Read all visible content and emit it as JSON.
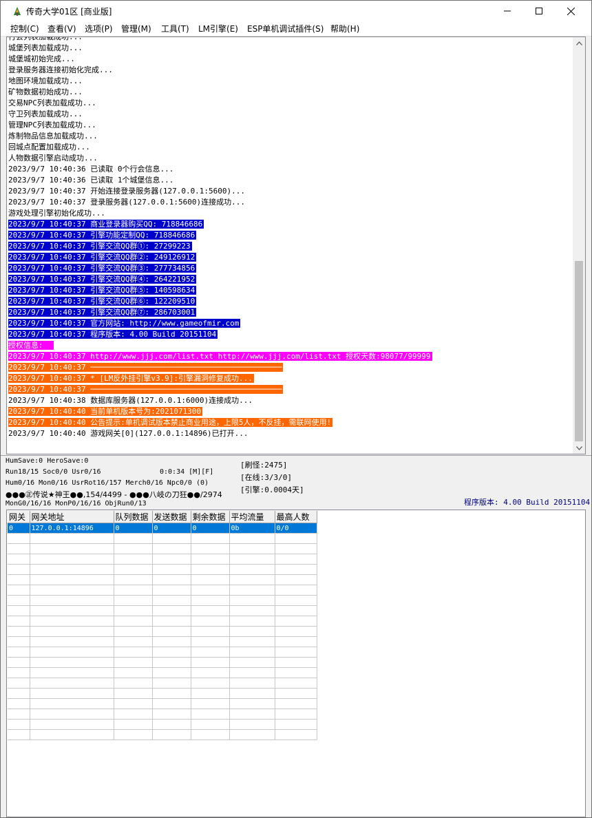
{
  "window": {
    "title": "传奇大学01区 [商业版]"
  },
  "menu": [
    {
      "label": "控制(C)"
    },
    {
      "label": "查看(V)"
    },
    {
      "label": "选项(P)"
    },
    {
      "label": "管理(M)"
    },
    {
      "label": "工具(T)"
    },
    {
      "label": "LM引擎(E)"
    },
    {
      "label": "ESP单机调试插件(S)"
    },
    {
      "label": "帮助(H)"
    }
  ],
  "log": [
    {
      "text": "行会列表加载成功...",
      "style": "plain"
    },
    {
      "text": "城堡列表加载成功...",
      "style": "plain"
    },
    {
      "text": "城堡城初始完成...",
      "style": "plain"
    },
    {
      "text": "登录服务器连接初始化完成...",
      "style": "plain"
    },
    {
      "text": "地图环境加载成功...",
      "style": "plain"
    },
    {
      "text": "矿物数据初始成功...",
      "style": "plain"
    },
    {
      "text": "交易NPC列表加载成功...",
      "style": "plain"
    },
    {
      "text": "守卫列表加载成功...",
      "style": "plain"
    },
    {
      "text": "管理NPC列表加载成功...",
      "style": "plain"
    },
    {
      "text": "炼制物品信息加载成功...",
      "style": "plain"
    },
    {
      "text": "回城点配置加载成功...",
      "style": "plain"
    },
    {
      "text": "人物数据引擎启动成功...",
      "style": "plain"
    },
    {
      "text": "2023/9/7 10:40:36 已读取 0个行会信息...",
      "style": "plain"
    },
    {
      "text": "2023/9/7 10:40:36 已读取 1个城堡信息...",
      "style": "plain"
    },
    {
      "text": "2023/9/7 10:40:37 开始连接登录服务器(127.0.0.1:5600)...",
      "style": "plain"
    },
    {
      "text": "2023/9/7 10:40:37 登录服务器(127.0.0.1:5600)连接成功...",
      "style": "plain"
    },
    {
      "text": "游戏处理引擎初始化成功...",
      "style": "plain"
    },
    {
      "text": "2023/9/7 10:40:37 商业登录器购买QQ: 718846686",
      "style": "blue"
    },
    {
      "text": "2023/9/7 10:40:37 引擎功能定制QQ: 718846686",
      "style": "blue"
    },
    {
      "text": "2023/9/7 10:40:37 引擎交流QQ群①: 27299223",
      "style": "blue"
    },
    {
      "text": "2023/9/7 10:40:37 引擎交流QQ群②: 249126912",
      "style": "blue"
    },
    {
      "text": "2023/9/7 10:40:37 引擎交流QQ群③: 277734856",
      "style": "blue"
    },
    {
      "text": "2023/9/7 10:40:37 引擎交流QQ群④: 264221952",
      "style": "blue"
    },
    {
      "text": "2023/9/7 10:40:37 引擎交流QQ群⑤: 140598634",
      "style": "blue"
    },
    {
      "text": "2023/9/7 10:40:37 引擎交流QQ群⑥: 122209510",
      "style": "blue"
    },
    {
      "text": "2023/9/7 10:40:37 引擎交流QQ群⑦: 286703001",
      "style": "blue"
    },
    {
      "text": "2023/9/7 10:40:37 官方网站: http://www.gameofmir.com",
      "style": "blue"
    },
    {
      "text": "2023/9/7 10:40:37 程序版本: 4.00 Build 20151104",
      "style": "blue"
    },
    {
      "text": "授权信息:  ",
      "style": "magenta"
    },
    {
      "text": "2023/9/7 10:40:37 http://www.jjj.com/list.txt http://www.jjj.com/list.txt 授权天数:98077/99999",
      "style": "magenta"
    },
    {
      "text": "2023/9/7 10:40:37 ──────────────────────────────────────────",
      "style": "orange"
    },
    {
      "text": "2023/9/7 10:40:37 * [LM反外挂引擎v3.9]:引擎漏洞修复成功...",
      "style": "orange"
    },
    {
      "text": "2023/9/7 10:40:37 ──────────────────────────────────────────",
      "style": "orange"
    },
    {
      "text": "2023/9/7 10:40:38 数据库服务器(127.0.0.1:6000)连接成功...",
      "style": "plain"
    },
    {
      "text": "2023/9/7 10:40:40 当前单机版本号为:2021071300",
      "style": "orange"
    },
    {
      "text": "2023/9/7 10:40:40 公告提示:单机调试版本禁止商业用途，上限5人，不反挂，需联网使用!",
      "style": "orange"
    },
    {
      "text": "2023/9/7 10:40:40 游戏网关[0](127.0.0.1:14896)已打开...",
      "style": "plain"
    }
  ],
  "status": {
    "line1": "HumSave:0 HeroSave:0",
    "line2_left": "Run18/15 Soc0/0 Usr0/16",
    "line2_mid": "0:0:34 [M][F]",
    "line3": "Hum0/16 Mon0/16 UsrRot16/157 Merch0/16 Npc0/0 (0)",
    "line4": "●●●㊣传说★神王●●,154/4499 - ●●●八岐の刀狂●●/2974",
    "line5": "MonG0/16/16 MonP0/16/16 ObjRun0/13",
    "refresh": "[刷怪:2475]",
    "online": "[在线:3/3/0]",
    "engine": "[引擎:0.0004天]",
    "version": "程序版本: 4.00 Build 20151104"
  },
  "gateway_table": {
    "columns": [
      "网关",
      "网关地址",
      "队列数据",
      "发送数据",
      "剩余数据",
      "平均流量",
      "最高人数"
    ],
    "rows": [
      [
        "0",
        "127.0.0.1:14896",
        "0",
        "0",
        "0",
        "0b",
        "0/0"
      ]
    ],
    "empty_rows": 20
  },
  "colors": {
    "highlight_blue": "#0000cc",
    "highlight_magenta": "#ff00ff",
    "highlight_orange": "#ff6600",
    "selection": "#0078d7",
    "version_text": "#000080"
  }
}
